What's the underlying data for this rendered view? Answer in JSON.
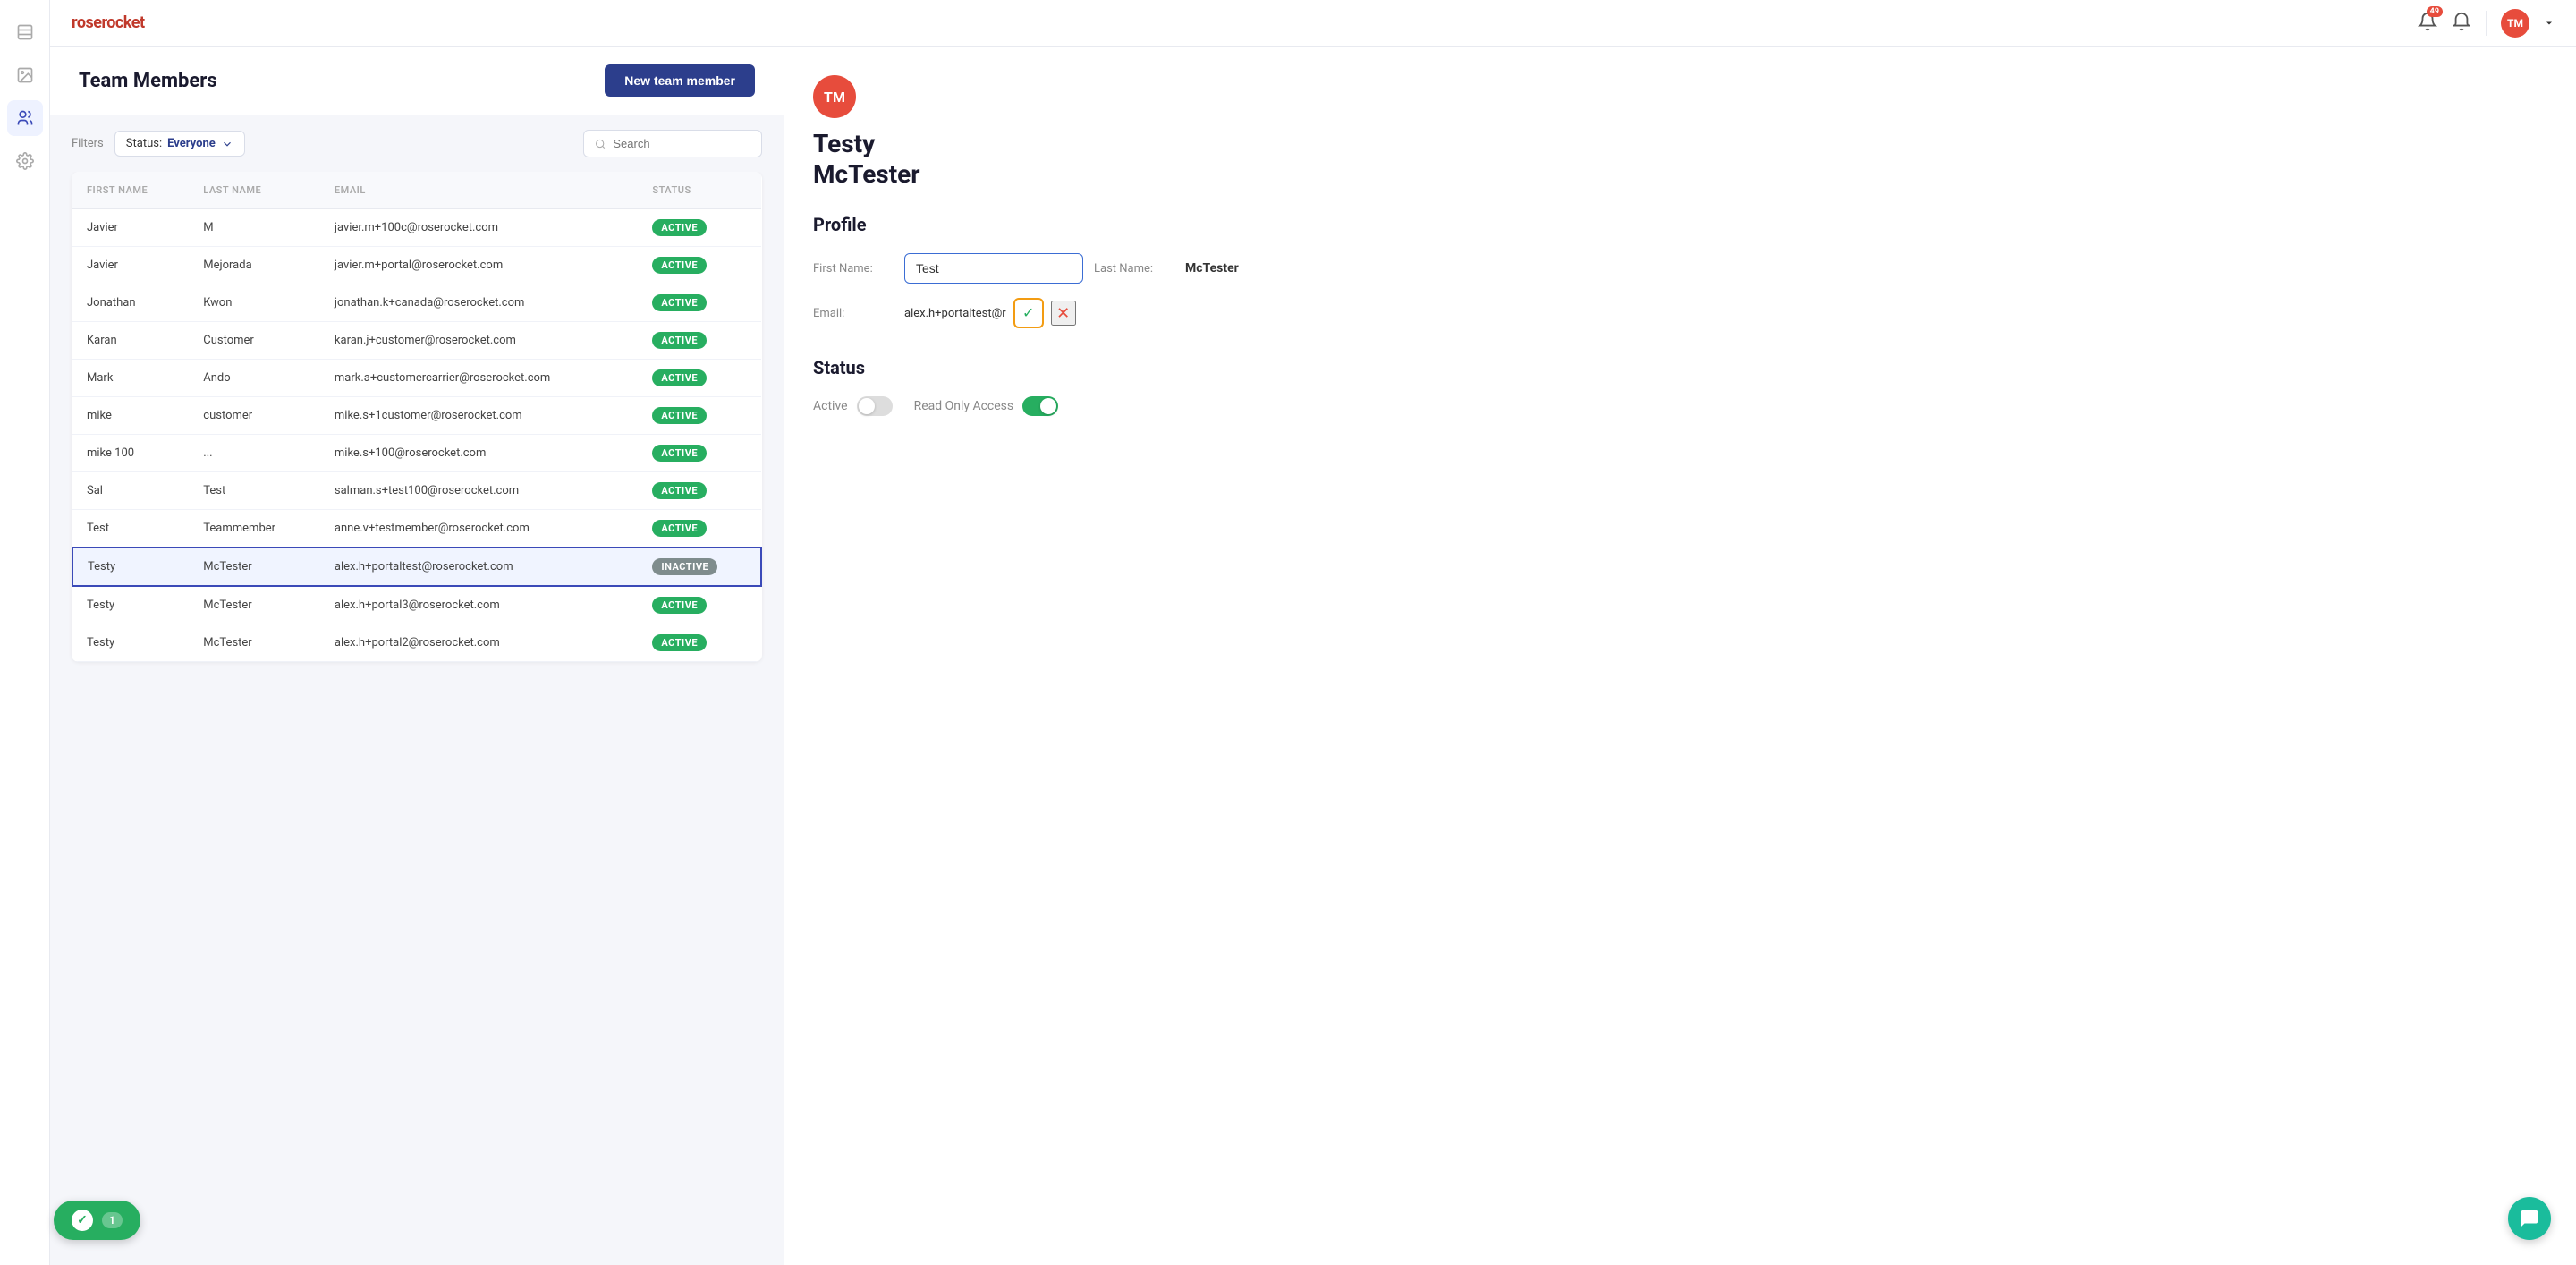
{
  "app": {
    "logo": "roserocket",
    "notifications_count": "49",
    "user_initials": "TM"
  },
  "page": {
    "title": "Team Members",
    "new_button_label": "New team member"
  },
  "filters": {
    "label": "Filters",
    "status_label": "Status:",
    "status_value": "Everyone",
    "search_placeholder": "Search"
  },
  "table": {
    "columns": [
      "FIRST NAME",
      "LAST NAME",
      "EMAIL",
      "STATUS"
    ],
    "rows": [
      {
        "first": "Javier",
        "last": "M",
        "email": "javier.m+100c@roserocket.com",
        "status": "ACTIVE"
      },
      {
        "first": "Javier",
        "last": "Mejorada",
        "email": "javier.m+portal@roserocket.com",
        "status": "ACTIVE"
      },
      {
        "first": "Jonathan",
        "last": "Kwon",
        "email": "jonathan.k+canada@roserocket.com",
        "status": "ACTIVE"
      },
      {
        "first": "Karan",
        "last": "Customer",
        "email": "karan.j+customer@roserocket.com",
        "status": "ACTIVE"
      },
      {
        "first": "Mark",
        "last": "Ando",
        "email": "mark.a+customercarrier@roserocket.com",
        "status": "ACTIVE"
      },
      {
        "first": "mike",
        "last": "customer",
        "email": "mike.s+1customer@roserocket.com",
        "status": "ACTIVE"
      },
      {
        "first": "mike 100",
        "last": "...",
        "email": "mike.s+100@roserocket.com",
        "status": "ACTIVE"
      },
      {
        "first": "Sal",
        "last": "Test",
        "email": "salman.s+test100@roserocket.com",
        "status": "ACTIVE"
      },
      {
        "first": "Test",
        "last": "Teammember",
        "email": "anne.v+testmember@roserocket.com",
        "status": "ACTIVE"
      },
      {
        "first": "Testy",
        "last": "McTester",
        "email": "alex.h+portaltest@roserocket.com",
        "status": "INACTIVE",
        "selected": true
      },
      {
        "first": "Testy",
        "last": "McTester",
        "email": "alex.h+portal3@roserocket.com",
        "status": "ACTIVE"
      },
      {
        "first": "Testy",
        "last": "McTester",
        "email": "alex.h+portal2@roserocket.com",
        "status": "ACTIVE"
      }
    ]
  },
  "detail": {
    "avatar_initials": "TM",
    "member_name_line1": "Testy",
    "member_name_line2": "McTester",
    "profile_section": "Profile",
    "first_name_label": "First Name:",
    "first_name_value": "Test",
    "last_name_label": "Last Name:",
    "last_name_value": "McTester",
    "email_label": "Email:",
    "email_value": "alex.h+portaltest@r",
    "status_section": "Status",
    "active_label": "Active",
    "read_only_label": "Read Only Access"
  },
  "toast": {
    "count": "1",
    "check": "✓"
  },
  "sidebar": {
    "icons": [
      {
        "name": "document-icon",
        "symbol": "📄",
        "active": false
      },
      {
        "name": "image-icon",
        "symbol": "🖼",
        "active": false
      },
      {
        "name": "team-icon",
        "symbol": "👥",
        "active": true
      },
      {
        "name": "settings-icon",
        "symbol": "⚙",
        "active": false
      }
    ]
  }
}
